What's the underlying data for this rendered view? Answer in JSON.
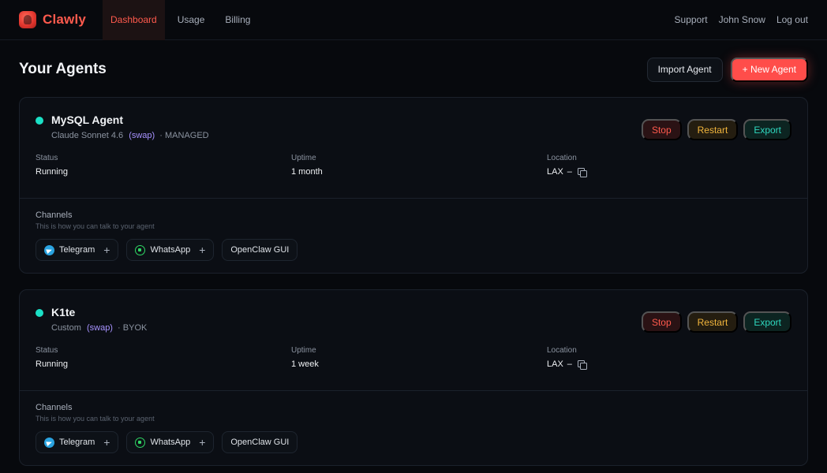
{
  "brand": {
    "name": "Clawly"
  },
  "nav": {
    "links": [
      {
        "label": "Dashboard",
        "active": true
      },
      {
        "label": "Usage"
      },
      {
        "label": "Billing"
      }
    ],
    "right": {
      "support": "Support",
      "user": "John Snow",
      "logout": "Log out"
    }
  },
  "page": {
    "title": "Your Agents",
    "import_label": "Import Agent",
    "new_label": "+ New Agent"
  },
  "colors": {
    "accent": "#ff4d4a",
    "running": "#1be0c6",
    "swap": "#a792ff"
  },
  "agents": [
    {
      "name": "MySQL Agent",
      "model": "Claude Sonnet 4.6",
      "swap": "(swap)",
      "mode": "· MANAGED",
      "actions": {
        "stop": "Stop",
        "restart": "Restart",
        "export": "Export"
      },
      "status_label": "Status",
      "status": "Running",
      "uptime_label": "Uptime",
      "uptime": "1 month",
      "location_label": "Location",
      "location": "LAX",
      "location_sep": "–",
      "channels_title": "Channels",
      "channels_sub": "This is how you can talk to your agent",
      "channels": {
        "telegram": "Telegram",
        "whatsapp": "WhatsApp",
        "gui": "OpenClaw GUI",
        "plus": "+"
      }
    },
    {
      "name": "K1te",
      "model": "Custom",
      "swap": "(swap)",
      "mode": "· BYOK",
      "actions": {
        "stop": "Stop",
        "restart": "Restart",
        "export": "Export"
      },
      "status_label": "Status",
      "status": "Running",
      "uptime_label": "Uptime",
      "uptime": "1 week",
      "location_label": "Location",
      "location": "LAX",
      "location_sep": "–",
      "channels_title": "Channels",
      "channels_sub": "This is how you can talk to your agent",
      "channels": {
        "telegram": "Telegram",
        "whatsapp": "WhatsApp",
        "gui": "OpenClaw GUI",
        "plus": "+"
      }
    }
  ]
}
